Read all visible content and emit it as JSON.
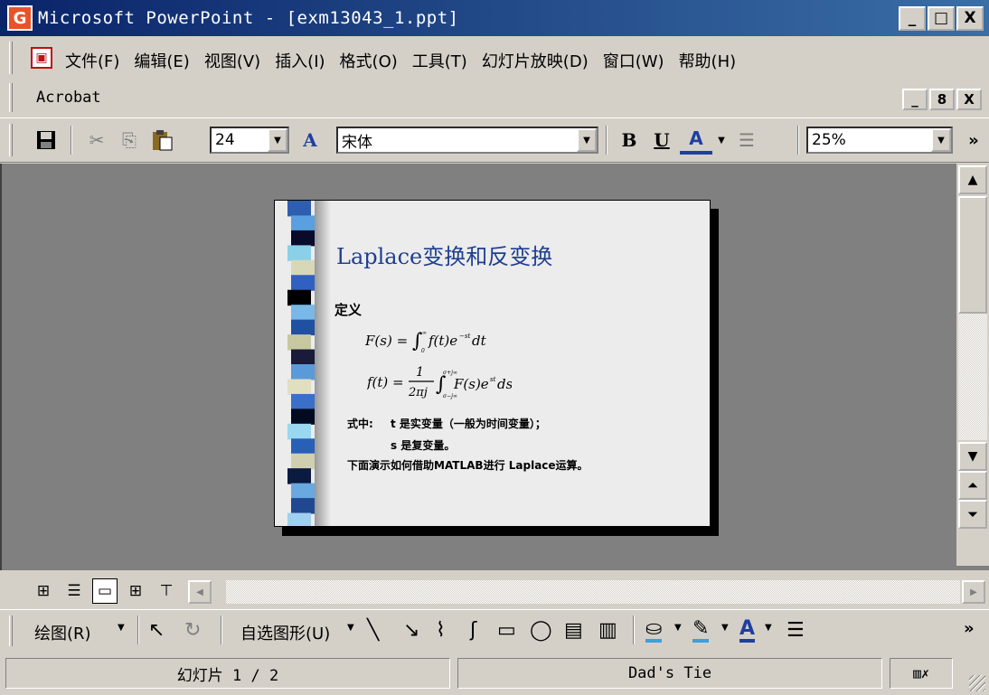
{
  "window": {
    "app_icon": "G",
    "title": "Microsoft PowerPoint - [exm13043_1.ppt]",
    "buttons": [
      "_",
      "□",
      "X"
    ]
  },
  "menu": {
    "items": [
      "文件(F)",
      "编辑(E)",
      "视图(V)",
      "插入(I)",
      "格式(O)",
      "工具(T)",
      "幻灯片放映(D)",
      "窗口(W)",
      "帮助(H)"
    ],
    "acrobat": "Acrobat",
    "mdi_buttons": [
      "_",
      "8",
      "X"
    ]
  },
  "toolbar": {
    "font_size": "24",
    "font_name": "宋体",
    "zoom": "25%",
    "bold": "B",
    "underline": "U",
    "font_color": "A",
    "grow_font": "A",
    "more": "»"
  },
  "slide": {
    "title": "Laplace变换和反变换",
    "definition_label": "定义",
    "formula1": "F(s) = ∫₀^∞ f(t)e⁻ˢᵗ dt",
    "formula2": "f(t) = (1/2πj) ∫ F(s)eˢᵗ ds",
    "note1_label": "式中:",
    "note1": "t 是实变量（一般为时间变量）；",
    "note2": "s 是复变量。",
    "note3": "下面演示如何借助MATLAB进行 Laplace运算。",
    "strip_colors": [
      "#2e5eb0",
      "#5aa0e0",
      "#0a0a2a",
      "#8ad0e8",
      "#d8d8b8",
      "#3060c0",
      "#000000",
      "#7ab8e8",
      "#2050a0",
      "#c8c8a0",
      "#1a1a3a",
      "#5a9ad8",
      "#e0e0c0",
      "#3a70c8",
      "#000a20",
      "#9ad8f0",
      "#2860b8",
      "#d0d0b0",
      "#0a1a40",
      "#6aa8e0",
      "#204890",
      "#a0d0f0"
    ]
  },
  "viewbar": {
    "buttons": [
      "normal-view",
      "outline-view",
      "slide-view",
      "slide-sorter-view",
      "slide-show-view"
    ]
  },
  "drawbar": {
    "draw_label": "绘图(R)",
    "autoshapes_label": "自选图形(U)"
  },
  "status": {
    "slide_info": "幻灯片 1 / 2",
    "design": "Dad's Tie"
  }
}
